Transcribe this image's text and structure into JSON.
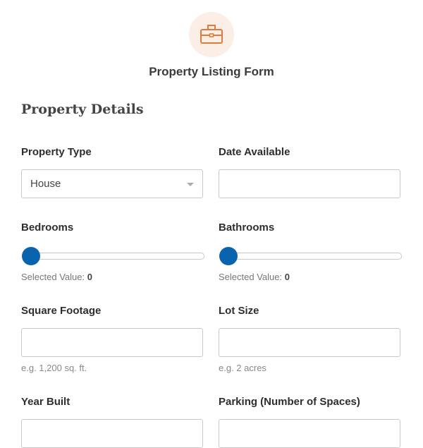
{
  "header": {
    "icon": "briefcase-icon",
    "title": "Property Listing Form",
    "accent_color": "#e07b39"
  },
  "section": {
    "title": "Property Details"
  },
  "fields": {
    "property_type": {
      "label": "Property Type",
      "value": "House"
    },
    "date_available": {
      "label": "Date Available",
      "value": ""
    },
    "bedrooms": {
      "label": "Bedrooms",
      "selected_prefix": "Selected Value:",
      "value": "0"
    },
    "bathrooms": {
      "label": "Bathrooms",
      "selected_prefix": "Selected Value:",
      "value": "0"
    },
    "square_footage": {
      "label": "Square Footage",
      "value": "",
      "hint": "e.g. 1,200 sq. ft."
    },
    "lot_size": {
      "label": "Lot Size",
      "value": "",
      "hint": "e.g. 2 acres"
    },
    "year_built": {
      "label": "Year Built",
      "value": ""
    },
    "parking": {
      "label": "Parking (Number of Spaces)",
      "value": ""
    }
  }
}
